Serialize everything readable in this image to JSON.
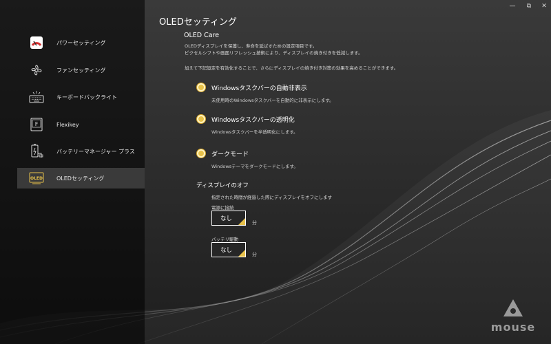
{
  "window": {
    "minimize": "—",
    "restore": "⧉",
    "close": "✕"
  },
  "sidebar": {
    "items": [
      {
        "label": "パワーセッティング",
        "icon": "power-setting-icon",
        "active": false
      },
      {
        "label": "ファンセッティング",
        "icon": "fan-icon",
        "active": false
      },
      {
        "label": "キーボードバックライト",
        "icon": "keyboard-backlight-icon",
        "active": false
      },
      {
        "label": "Flexikey",
        "icon": "flexikey-icon",
        "icon_text": "F",
        "active": false
      },
      {
        "label": "バッテリーマネージャー プラス",
        "icon": "battery-manager-icon",
        "active": false
      },
      {
        "label": "OLEDセッティング",
        "icon": "oled-icon",
        "icon_text": "OLED",
        "active": true
      }
    ]
  },
  "main": {
    "title": "OLEDセッティング",
    "oled_care": {
      "heading": "OLED Care",
      "desc1": "OLEDディスプレイを保護し、寿命を延ばすための設定項目です。",
      "desc2": "ピクセルシフトや画面リフレッシュ技術により、ディスプレイの焼き付きを低減します。",
      "desc3": "加えて下記設定を有効化することで、さらにディスプレイの焼き付き対策の効果を高めることができます。"
    },
    "options": [
      {
        "label": "Windowsタスクバーの自動非表示",
        "desc": "未使用時のWindowsタスクバーを自動的に非表示にします。",
        "checked": true
      },
      {
        "label": "Windowsタスクバーの透明化",
        "desc": "Windowsタスクバーを半透明化にします。",
        "checked": true
      },
      {
        "label": "ダークモード",
        "desc": "Windowsテーマをダークモードにします。",
        "checked": true
      }
    ],
    "display_off": {
      "heading": "ディスプレイのオフ",
      "desc": "指定された時間が経過した際にディスプレイをオフにします",
      "ac": {
        "label": "電源に接続",
        "value": "なし",
        "unit": "分"
      },
      "battery": {
        "label": "バッテリ駆動",
        "value": "なし",
        "unit": "分"
      }
    }
  },
  "brand": {
    "logo_text": "mouse"
  },
  "colors": {
    "accent": "#e8c24a",
    "background": "#2b2b2b",
    "sidebar": "#111111",
    "active_item": "#3a3a3a"
  }
}
